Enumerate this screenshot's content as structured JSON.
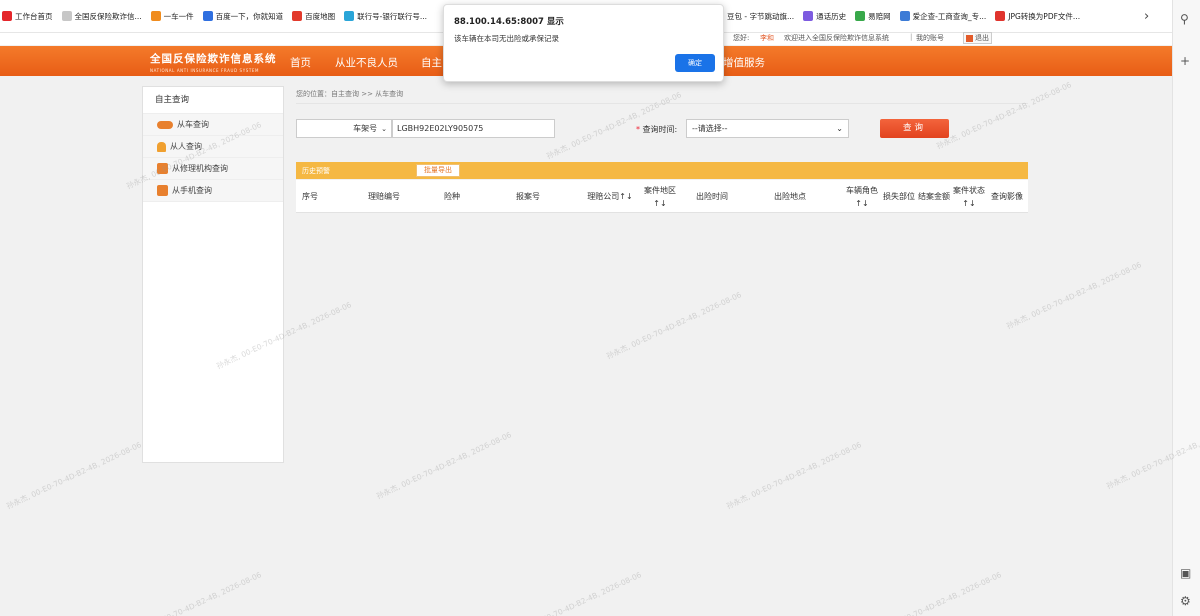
{
  "bookmarks": [
    {
      "label": "工作台首页",
      "color": "#e4262b"
    },
    {
      "label": "全国反保险欺诈信...",
      "color": "#c7c7c7"
    },
    {
      "label": "一车一件",
      "color": "#f08c1e"
    },
    {
      "label": "百度一下，你就知道",
      "color": "#2f6fe0"
    },
    {
      "label": "百度地图",
      "color": "#e23a2c"
    },
    {
      "label": "联行号-银行联行号...",
      "color": "#2aa5d8"
    },
    {
      "label": "豆包 - 字节跳动旗...",
      "color": "#6a8cff"
    },
    {
      "label": "通话历史",
      "color": "#7d5be0"
    },
    {
      "label": "易赔网",
      "color": "#38a84a"
    },
    {
      "label": "爱企查-工商查询_专...",
      "color": "#3c7bd6"
    },
    {
      "label": "JPG转换为PDF文件...",
      "color": "#e0342d"
    }
  ],
  "userstrip": {
    "greet": "您好:",
    "username": "李和",
    "welcome": "欢迎进入全国反保险欺诈信息系统",
    "separator": "|",
    "my_account": "我的账号",
    "logout": "退出"
  },
  "logo": {
    "cn": "全国反保险欺诈信息系统",
    "en": "NATIONAL ANTI INSURANCE FRAUD SYSTEM"
  },
  "nav": [
    "首页",
    "从业不良人员",
    "自主",
    "增值服务"
  ],
  "sidebar": {
    "title": "自主查询",
    "items": [
      {
        "label": "从车查询",
        "color": "#e8802e"
      },
      {
        "label": "从人查询",
        "color": "#f0a030"
      },
      {
        "label": "从修理机构查询",
        "color": "#e8802e"
      },
      {
        "label": "从手机查询",
        "color": "#e8802e"
      }
    ]
  },
  "breadcrumb": "您的位置：自主查询 >> 从车查询",
  "search": {
    "field_type": "车架号",
    "vin_value": "LGBH92E02LY905075",
    "time_label": "查询时间:",
    "time_required": "*",
    "time_placeholder": "--请选择--",
    "query_button": "查询"
  },
  "history": {
    "label": "历史预警",
    "export_button": "批量导出"
  },
  "table": {
    "columns": [
      "序号",
      "理赔编号",
      "险种",
      "报案号",
      "理赔公司↑↓",
      "案件地区↑↓",
      "出险时间",
      "出险地点",
      "车辆角色↑↓",
      "损失部位",
      "结案金额",
      "案件状态↑↓",
      "查询影像"
    ]
  },
  "dialog": {
    "title": "88.100.14.65:8007 显示",
    "message": "该车辆在本司无出险或承保记录",
    "ok_button": "确定"
  },
  "watermark": "孙永杰, 00-E0-70-4D-B2-4B, 2026-08-06",
  "colors": {
    "nav_orange": "#e85d16",
    "history_bar": "#f5b843",
    "query_button": "#e2431f",
    "dialog_ok": "#1a73e8"
  }
}
